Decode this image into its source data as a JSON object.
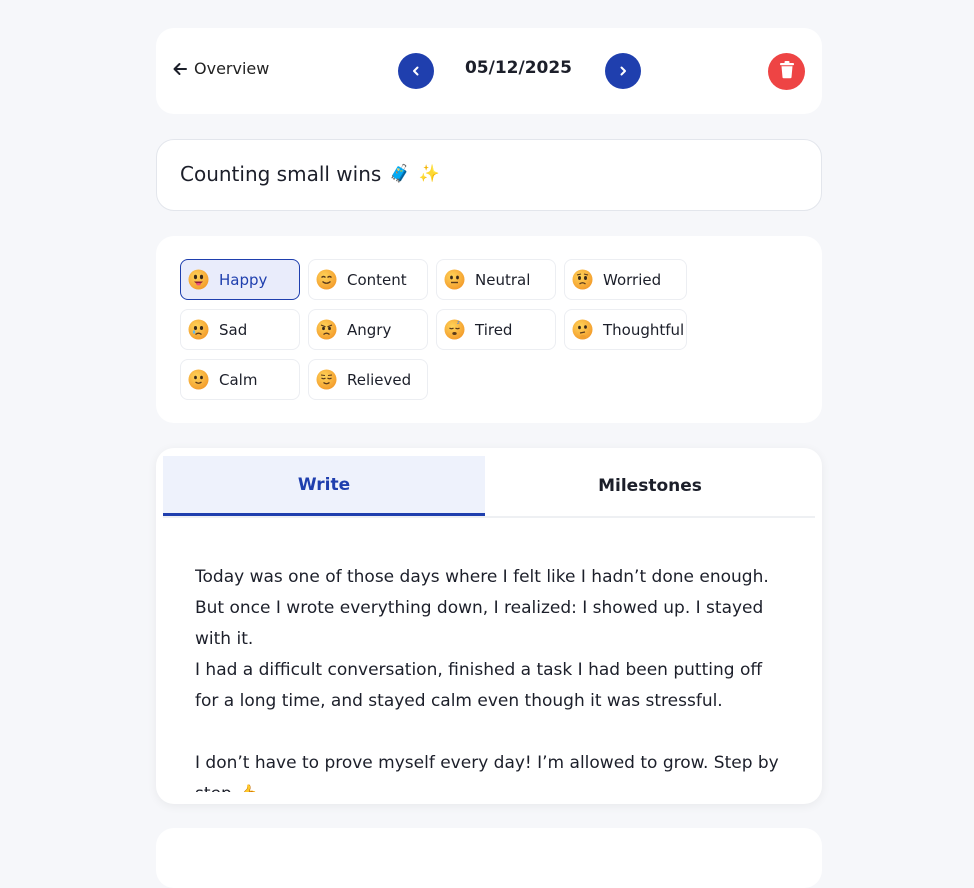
{
  "header": {
    "back_label": "Overview",
    "date": "05/12/2025"
  },
  "entry": {
    "title": "Counting small wins",
    "title_emojis": [
      "🧳",
      "✨"
    ]
  },
  "moods": [
    {
      "label": "Happy",
      "selected": true,
      "icon": "happy-face-icon"
    },
    {
      "label": "Content",
      "selected": false,
      "icon": "content-face-icon"
    },
    {
      "label": "Neutral",
      "selected": false,
      "icon": "neutral-face-icon"
    },
    {
      "label": "Worried",
      "selected": false,
      "icon": "worried-face-icon"
    },
    {
      "label": "Sad",
      "selected": false,
      "icon": "sad-face-icon"
    },
    {
      "label": "Angry",
      "selected": false,
      "icon": "angry-face-icon"
    },
    {
      "label": "Tired",
      "selected": false,
      "icon": "tired-face-icon"
    },
    {
      "label": "Thoughtful",
      "selected": false,
      "icon": "thoughtful-face-icon"
    },
    {
      "label": "Calm",
      "selected": false,
      "icon": "calm-face-icon"
    },
    {
      "label": "Relieved",
      "selected": false,
      "icon": "relieved-face-icon"
    }
  ],
  "tabs": [
    {
      "label": "Write",
      "active": true
    },
    {
      "label": "Milestones",
      "active": false
    }
  ],
  "editor": {
    "text": "Today was one of those days where I felt like I hadn’t done enough.\nBut once I wrote everything down, I realized: I showed up. I stayed with it.\nI had a difficult conversation, finished a task I had been putting off for a long time, and stayed calm even though it was stressful.\n\nI don’t have to prove myself every day! I’m allowed to grow. Step by step 👍"
  },
  "colors": {
    "accent": "#1f3fae",
    "delete": "#ee4444",
    "background": "#f6f7fa",
    "selected_chip_bg": "#e9ecfb"
  }
}
